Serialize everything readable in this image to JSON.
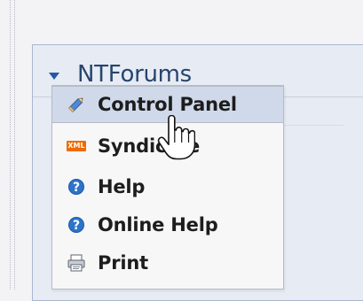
{
  "module": {
    "title": "NTForums"
  },
  "menu": {
    "items": [
      {
        "label": "Control Panel",
        "icon": "pencil-icon"
      },
      {
        "label": "Syndicate",
        "icon": "xml-icon"
      },
      {
        "label": "Help",
        "icon": "help-icon"
      },
      {
        "label": "Online Help",
        "icon": "help-icon"
      },
      {
        "label": "Print",
        "icon": "printer-icon"
      }
    ]
  },
  "icons": {
    "xml_text": "XML",
    "help_mark": "?"
  },
  "colors": {
    "module_bg": "#e7ebf3",
    "module_border": "#aab7d3",
    "menu_bg": "#f7f7f8",
    "menu_active_bg": "#cfd9ea",
    "title_text": "#27456f",
    "accent_blue": "#2558a8",
    "xml_orange": "#ef6a00",
    "help_blue": "#2d73c9"
  }
}
